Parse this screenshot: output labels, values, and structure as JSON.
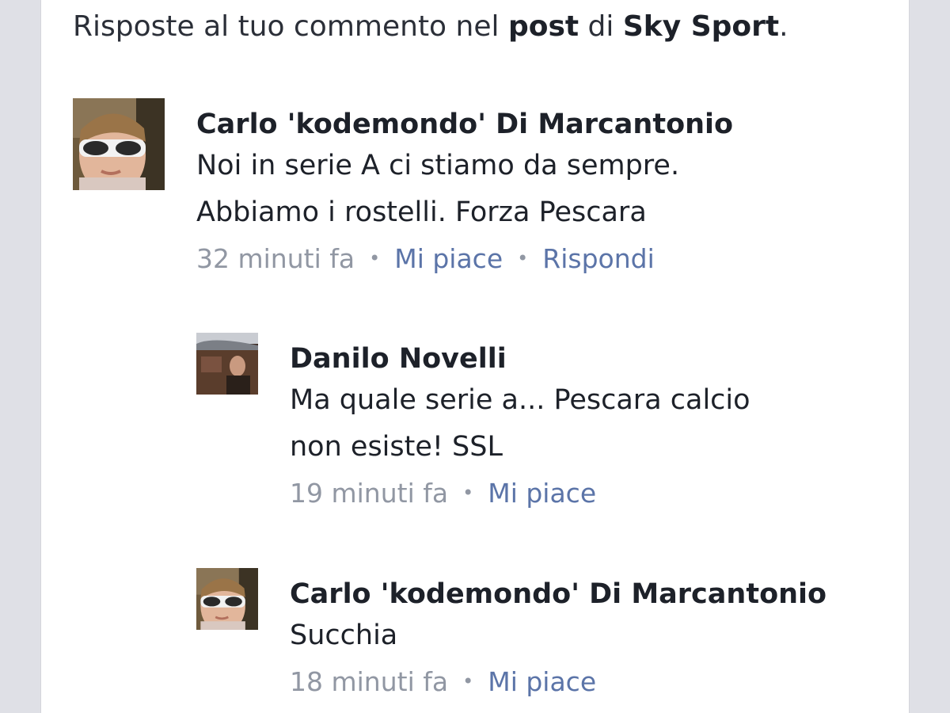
{
  "header": {
    "prefix": "Risposte al tuo commento nel ",
    "post_word": "post",
    "middle": " di ",
    "page_name": "Sky Sport",
    "suffix": "."
  },
  "comments": [
    {
      "author": "Carlo 'kodemondo' Di Marcantonio",
      "text_line1": "Noi in serie A ci stiamo da sempre.",
      "text_line2": "Abbiamo i rostelli. Forza Pescara",
      "time": "32 minuti fa",
      "like_label": "Mi piace",
      "reply_label": "Rispondi"
    },
    {
      "author": "Danilo Novelli",
      "text_line1": "Ma quale serie a... Pescara calcio",
      "text_line2": "non esiste! SSL",
      "time": "19 minuti fa",
      "like_label": "Mi piace"
    },
    {
      "author": "Carlo 'kodemondo' Di Marcantonio",
      "text_line1": "Succhia",
      "time": "18 minuti fa",
      "like_label": "Mi piace"
    }
  ],
  "separator": "•",
  "colors": {
    "background": "#dfe0e6",
    "card": "#ffffff",
    "link": "#5b74a8",
    "meta": "#9197a3",
    "text": "#1d2129"
  }
}
